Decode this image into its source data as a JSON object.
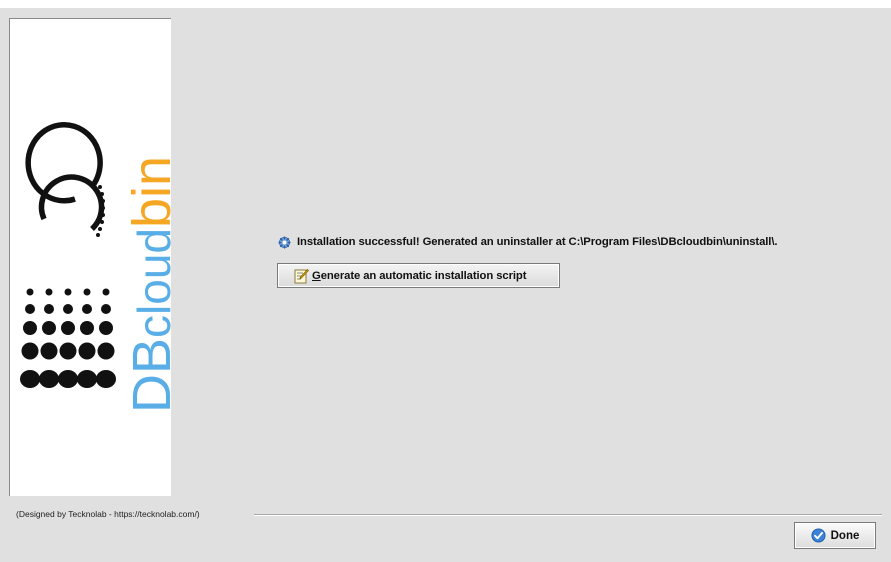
{
  "brand": {
    "logo_text_dark": "DB",
    "logo_text_cloud": "cloud",
    "logo_text_bin": "bin",
    "colors": {
      "dark": "#111111",
      "cloud": "#5aaee8",
      "bin": "#f5a623"
    }
  },
  "status": {
    "icon": "gear-icon",
    "message": "Installation successful! Generated an uninstaller at C:\\Program Files\\DBcloudbin\\uninstall\\."
  },
  "actions": {
    "generate_script": {
      "icon": "script-edit-icon",
      "mnemonic": "G",
      "label_rest": "enerate an automatic installation script"
    }
  },
  "footer": {
    "credits": "(Designed by Tecknolab - https://tecknolab.com/)",
    "done": {
      "icon": "check-circle-icon",
      "label": "Done"
    }
  },
  "colors": {
    "window_bg": "#e0e0e0",
    "accent_blue": "#3b82d8"
  }
}
